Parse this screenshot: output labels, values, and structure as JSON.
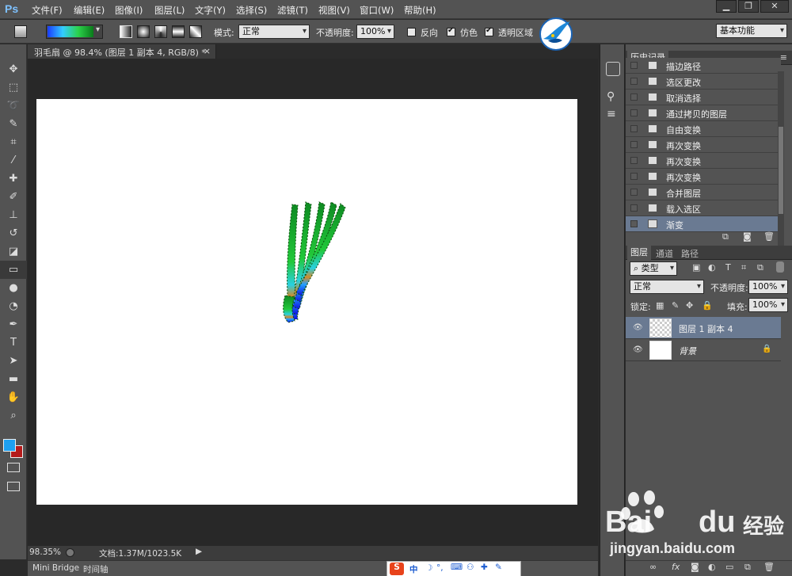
{
  "app": {
    "logo": "Ps"
  },
  "menu": [
    "文件(F)",
    "编辑(E)",
    "图像(I)",
    "图层(L)",
    "文字(Y)",
    "选择(S)",
    "滤镜(T)",
    "视图(V)",
    "窗口(W)",
    "帮助(H)"
  ],
  "window_controls": {
    "minimize": "▁",
    "restore": "❐",
    "close": "✕"
  },
  "options": {
    "mode_label": "模式:",
    "mode_value": "正常",
    "opacity_label": "不透明度:",
    "opacity_value": "100%",
    "reverse_label": "反向",
    "reverse_checked": false,
    "dither_label": "仿色",
    "dither_checked": true,
    "transparency_label": "透明区域",
    "transparency_checked": true,
    "workspace": "基本功能"
  },
  "document": {
    "tab_title": "羽毛扇 @ 98.4% (图层 1 副本 4, RGB/8) *",
    "tab_close": "×"
  },
  "status": {
    "zoom": "98.35%",
    "doc_info": "文档:1.37M/1023.5K"
  },
  "bottom_tabs": [
    "Mini Bridge",
    "时间轴"
  ],
  "ime_bar": [
    "中",
    "⌨"
  ],
  "history": {
    "tab_label": "历史记录",
    "items": [
      {
        "label": "描边路径"
      },
      {
        "label": "选区更改"
      },
      {
        "label": "取消选择"
      },
      {
        "label": "通过拷贝的图层"
      },
      {
        "label": "自由变换"
      },
      {
        "label": "再次变换"
      },
      {
        "label": "再次变换"
      },
      {
        "label": "再次变换"
      },
      {
        "label": "合并图层"
      },
      {
        "label": "载入选区"
      },
      {
        "label": "渐变"
      }
    ]
  },
  "layers": {
    "tabs": [
      "图层",
      "通道",
      "路径"
    ],
    "filter_label": "类型",
    "blend_mode": "正常",
    "opacity_label": "不透明度:",
    "opacity_value": "100%",
    "lock_label": "锁定:",
    "fill_label": "填充:",
    "fill_value": "100%",
    "items": [
      {
        "name": "图层 1 副本 4",
        "selected": true
      },
      {
        "name": "背景",
        "selected": false,
        "locked": true
      }
    ]
  },
  "colors": {
    "foreground": "#1ea0f0",
    "background": "#b51b1b",
    "selection": "#6a7a92"
  },
  "watermark": {
    "brand_text": "Bai",
    "brand_text2": "du",
    "brand_cn": "经验",
    "url": "jingyan.baidu.com"
  }
}
